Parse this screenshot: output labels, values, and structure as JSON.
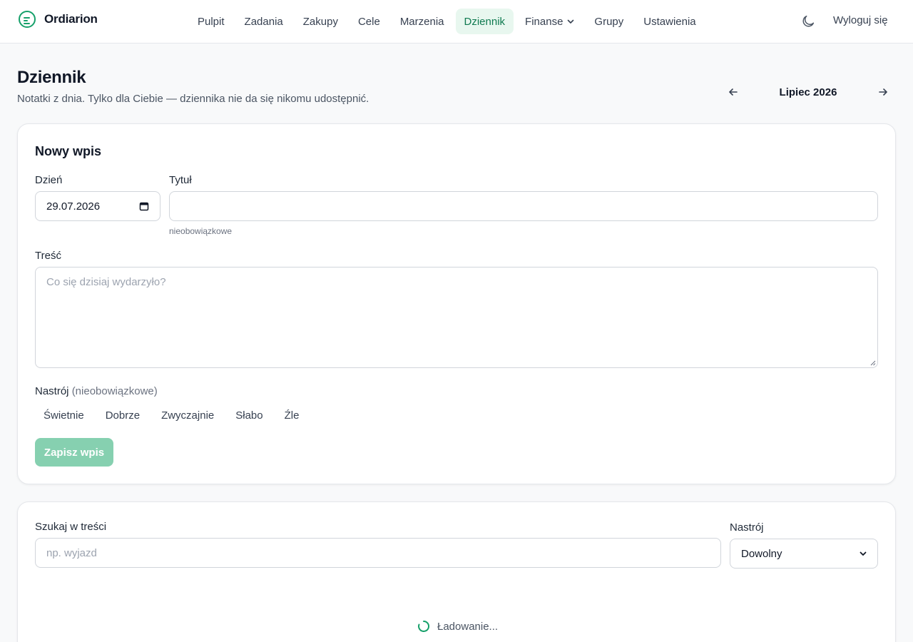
{
  "brand": {
    "name": "Ordiarion",
    "accent": "#16a06a"
  },
  "nav": {
    "items": [
      {
        "label": "Pulpit"
      },
      {
        "label": "Zadania"
      },
      {
        "label": "Zakupy"
      },
      {
        "label": "Cele"
      },
      {
        "label": "Marzenia"
      },
      {
        "label": "Dziennik",
        "active": true
      },
      {
        "label": "Finanse"
      },
      {
        "label": "Grupy"
      },
      {
        "label": "Ustawienia"
      }
    ],
    "logout": "Wyloguj się"
  },
  "page": {
    "title": "Dziennik",
    "subtitle": "Notatki z dnia. Tylko dla Ciebie — dziennika nie da się nikomu udostępnić.",
    "month": "Lipiec 2026"
  },
  "new_entry": {
    "title": "Nowy wpis",
    "day_label": "Dzień",
    "day_value": "29.07.2026",
    "title_label": "Tytuł",
    "title_value": "",
    "title_hint": "nieobowiązkowe",
    "content_label": "Treść",
    "content_placeholder": "Co się dzisiaj wydarzyło?",
    "mood_label": "Nastrój",
    "mood_optional": "(nieobowiązkowe)",
    "moods": [
      "Świetnie",
      "Dobrze",
      "Zwyczajnie",
      "Słabo",
      "Źle"
    ],
    "save_label": "Zapisz wpis"
  },
  "filters": {
    "search_label": "Szukaj w treści",
    "search_placeholder": "np. wyjazd",
    "mood_label": "Nastrój",
    "mood_value": "Dowolny"
  },
  "loading_text": "Ładowanie..."
}
